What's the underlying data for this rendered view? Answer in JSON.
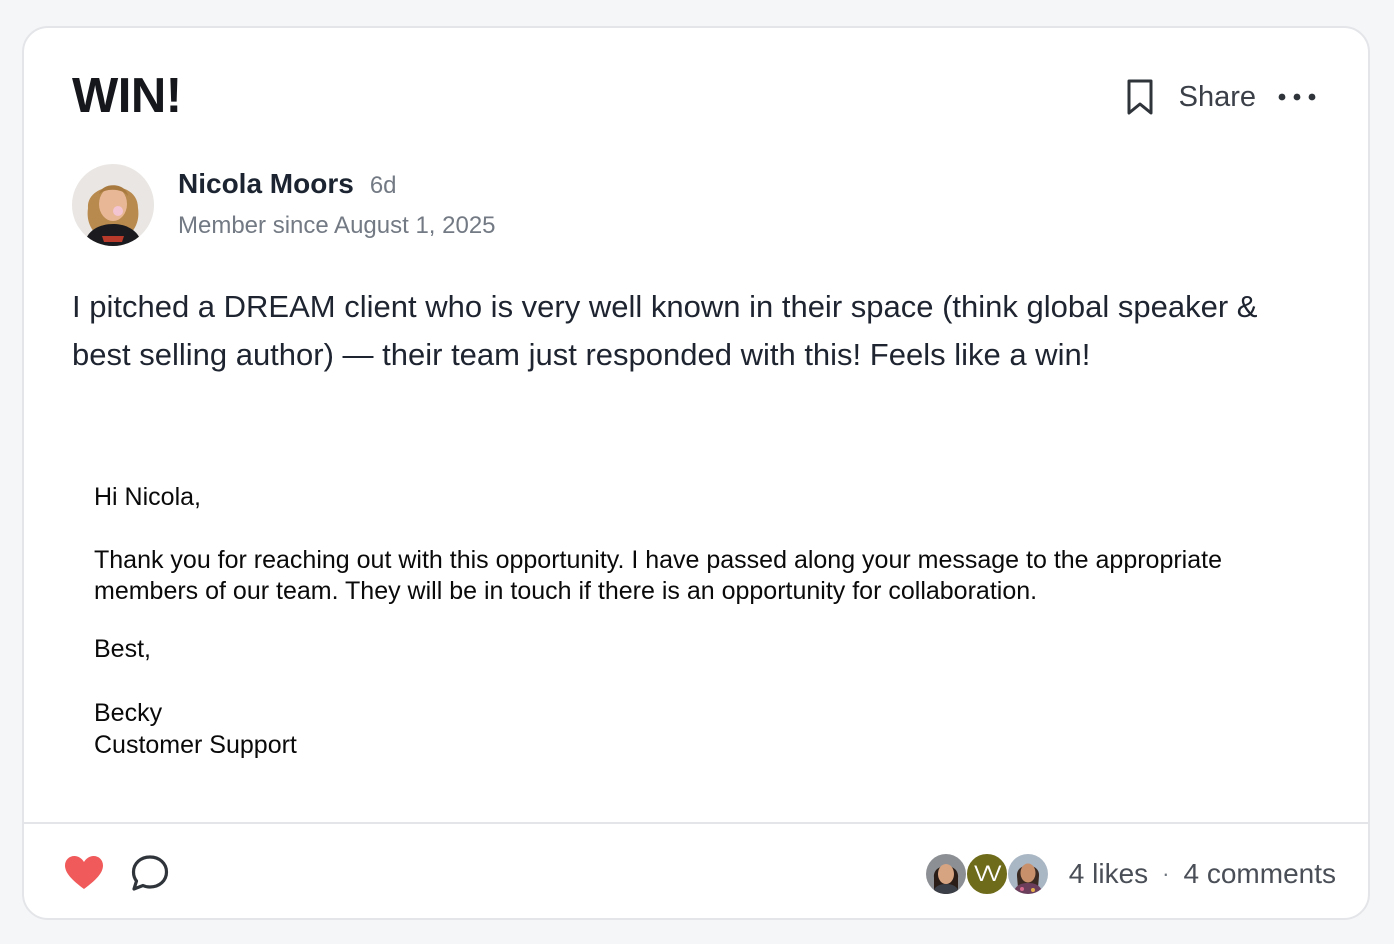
{
  "post": {
    "title": "WIN!",
    "share_label": "Share",
    "body": "I pitched a DREAM client who is very well known in their space (think global speaker & best selling author) — their team just responded with this! Feels like a win!"
  },
  "author": {
    "name": "Nicola Moors",
    "age": "6d",
    "member_since": "Member since August 1, 2025"
  },
  "email_image": {
    "greeting": "Hi Nicola,",
    "message": "Thank you for reaching out with this opportunity. I have passed along your message to the appropriate members of our team. They will be in touch if there is an opportunity for collaboration.",
    "closing": "Best,",
    "signer": "Becky",
    "signer_role": "Customer Support"
  },
  "engagement": {
    "likers": [
      {
        "type": "photo"
      },
      {
        "type": "initials",
        "initials": "VV"
      },
      {
        "type": "photo"
      }
    ],
    "likes": "4 likes",
    "separator": "·",
    "comments": "4 comments"
  },
  "colors": {
    "heart": "#f05a5a",
    "initials_avatar": "#6e6b1a"
  },
  "icons": [
    "bookmark-icon",
    "more-horizontal-icon",
    "heart-icon",
    "comment-icon"
  ]
}
